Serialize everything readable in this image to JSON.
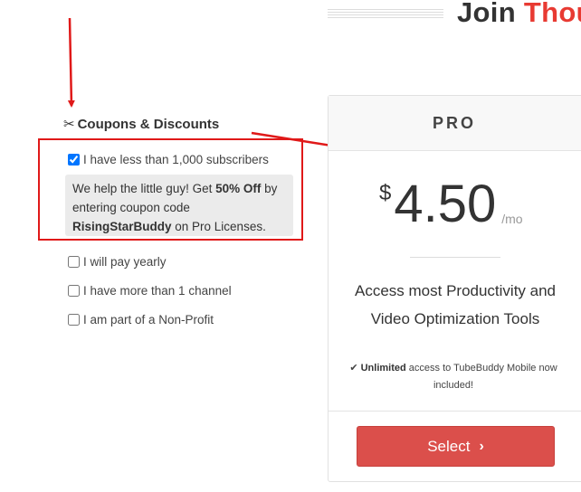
{
  "heading": {
    "prefix": "Join",
    "accent": "Thou"
  },
  "coupons": {
    "icon": "scissors-icon",
    "title": "Coupons & Discounts",
    "options": [
      {
        "label": "I have less than 1,000 subscribers",
        "checked": true
      },
      {
        "label": "I will pay yearly",
        "checked": false
      },
      {
        "label": "I have more than 1 channel",
        "checked": false
      },
      {
        "label": "I am part of a Non-Profit",
        "checked": false
      }
    ],
    "promo": {
      "text1": "We help the little guy! Get ",
      "bold1": "50% Off",
      "text2": " by entering coupon code ",
      "bold2": "RisingStarBuddy",
      "text3": " on Pro Licenses."
    }
  },
  "plan": {
    "name": "PRO",
    "currency": "$",
    "price": "4.50",
    "period": "/mo",
    "description": "Access most Productivity and Video Optimization Tools",
    "feature_bold": "Unlimited",
    "feature_text": " access to TubeBuddy Mobile now included!",
    "select_label": "Select"
  },
  "colors": {
    "accent": "#e83a32",
    "button": "#db4f4b",
    "annotation": "#e01919"
  }
}
